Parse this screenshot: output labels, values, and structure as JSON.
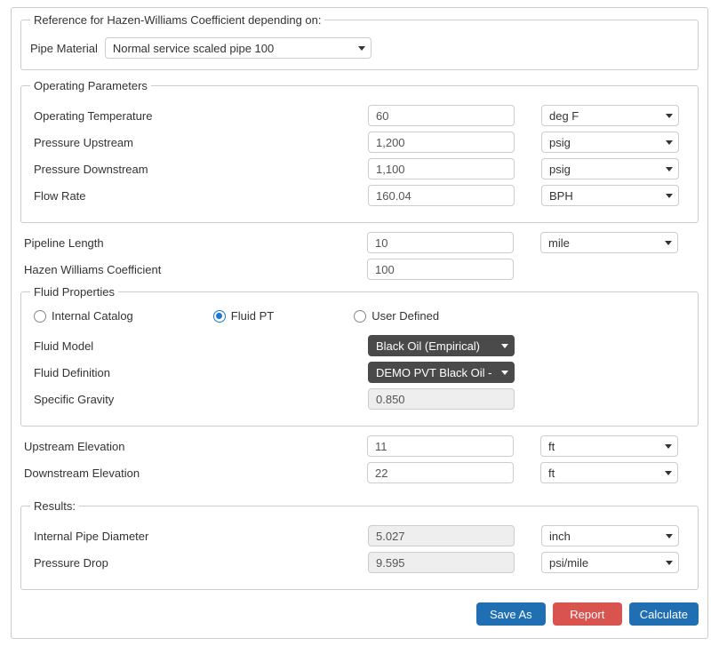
{
  "reference": {
    "legend": "Reference for Hazen-Williams Coefficient depending on:",
    "pipe_material_label": "Pipe Material",
    "pipe_material_value": "Normal service scaled pipe 100"
  },
  "operating": {
    "legend": "Operating Parameters",
    "temp_label": "Operating Temperature",
    "temp_value": "60",
    "temp_unit": "deg F",
    "p_up_label": "Pressure Upstream",
    "p_up_value": "1,200",
    "p_up_unit": "psig",
    "p_down_label": "Pressure Downstream",
    "p_down_value": "1,100",
    "p_down_unit": "psig",
    "flow_label": "Flow Rate",
    "flow_value": "160.04",
    "flow_unit": "BPH"
  },
  "pipeline_length": {
    "label": "Pipeline Length",
    "value": "10",
    "unit": "mile"
  },
  "hw_coeff": {
    "label": "Hazen Williams Coefficient",
    "value": "100"
  },
  "fluid": {
    "legend": "Fluid Properties",
    "opt_internal": "Internal Catalog",
    "opt_pt": "Fluid PT",
    "opt_user": "User Defined",
    "selected": "pt",
    "model_label": "Fluid Model",
    "model_value": "Black Oil (Empirical)",
    "def_label": "Fluid Definition",
    "def_value": "DEMO PVT Black Oil - DEM",
    "sg_label": "Specific Gravity",
    "sg_value": "0.850"
  },
  "up_elev": {
    "label": "Upstream Elevation",
    "value": "11",
    "unit": "ft"
  },
  "down_elev": {
    "label": "Downstream Elevation",
    "value": "22",
    "unit": "ft"
  },
  "results": {
    "legend": "Results:",
    "diam_label": "Internal Pipe Diameter",
    "diam_value": "5.027",
    "diam_unit": "inch",
    "drop_label": "Pressure Drop",
    "drop_value": "9.595",
    "drop_unit": "psi/mile"
  },
  "buttons": {
    "save_as": "Save As",
    "report": "Report",
    "calculate": "Calculate"
  }
}
